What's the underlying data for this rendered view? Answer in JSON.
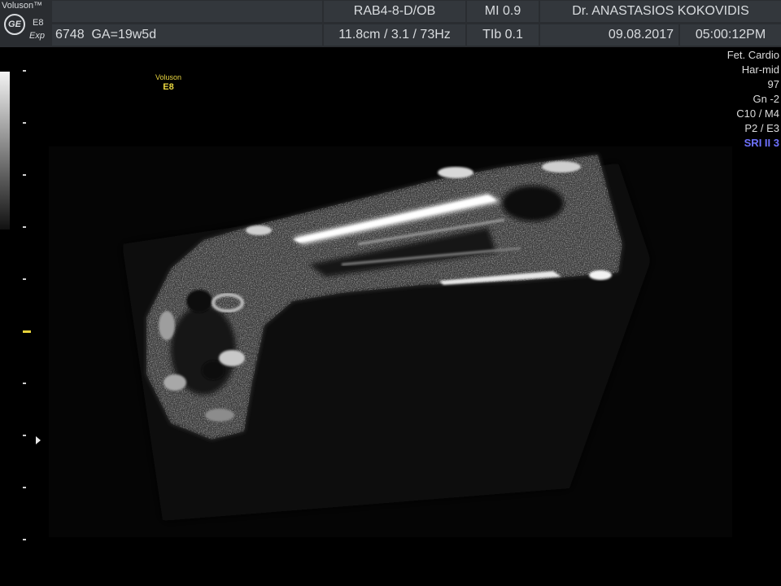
{
  "header": {
    "brand": "Voluson™",
    "logo": "GE",
    "model": "E8",
    "expert": "Exp",
    "patient_id": "6748",
    "gestational_age": "GA=19w5d",
    "probe": "RAB4-8-D/OB",
    "mechanical_index": "MI  0.9",
    "doctor": "Dr. ANASTASIOS KOKOVIDIS",
    "scan_params": "11.8cm / 3.1 / 73Hz",
    "thermal_index": "TIb  0.1",
    "date": "09.08.2017",
    "time": "05:00:12PM"
  },
  "watermark": {
    "line1": "Voluson",
    "line2": "E8"
  },
  "parameters": [
    {
      "text": "Fet. Cardio"
    },
    {
      "text": "Har-mid"
    },
    {
      "text": "97"
    },
    {
      "text": "Gn  -2"
    },
    {
      "text": "C10 / M4"
    },
    {
      "text": "P2 / E3"
    }
  ],
  "sri": "SRI II 3",
  "colors": {
    "header_bg": "#2a2d31",
    "cell_bg": "#33373c",
    "text": "#d9dcdf",
    "marker": "#e6d23b",
    "sri": "#6f72ff"
  },
  "icons": [
    "ge-logo-icon",
    "focus-marker-icon",
    "pointer-arrow-icon"
  ]
}
